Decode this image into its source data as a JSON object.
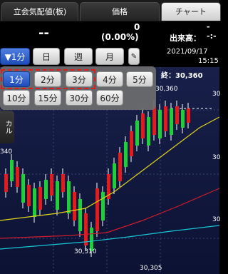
{
  "tabs": [
    {
      "label": "立会気配値(板)"
    },
    {
      "label": "価格"
    },
    {
      "label": "チャート"
    }
  ],
  "quote": {
    "price": "--",
    "change": "0",
    "change_pct": "(0.00%)",
    "volume_label": "出来高：",
    "volume_value": "--:-"
  },
  "toolbar": {
    "interval_selected": "▼1分",
    "day_label": "日",
    "week_label": "週",
    "month_label": "月",
    "date": "2021/09/17",
    "time": "15:15",
    "close_label": "終：30,360"
  },
  "popup": {
    "row1": [
      "1分",
      "2分",
      "3分",
      "4分",
      "5分"
    ],
    "row2": [
      "10分",
      "15分",
      "30分",
      "60分"
    ],
    "selected": "1分"
  },
  "chart_labels": {
    "high_price": "30,360",
    "low_price": "30,310",
    "bottom_price": "30,305",
    "left_price": "340",
    "side_tab": "カル",
    "axis_right_1": "30",
    "axis_right_2": "30",
    "axis_right_3": "30"
  },
  "colors": {
    "up": "#e31b1b",
    "down": "#1fcf3a",
    "ma_short": "#e0d21c",
    "ma_mid": "#d11b2c",
    "ma_long": "#19c6d8",
    "selection": "#e31b1b"
  }
}
